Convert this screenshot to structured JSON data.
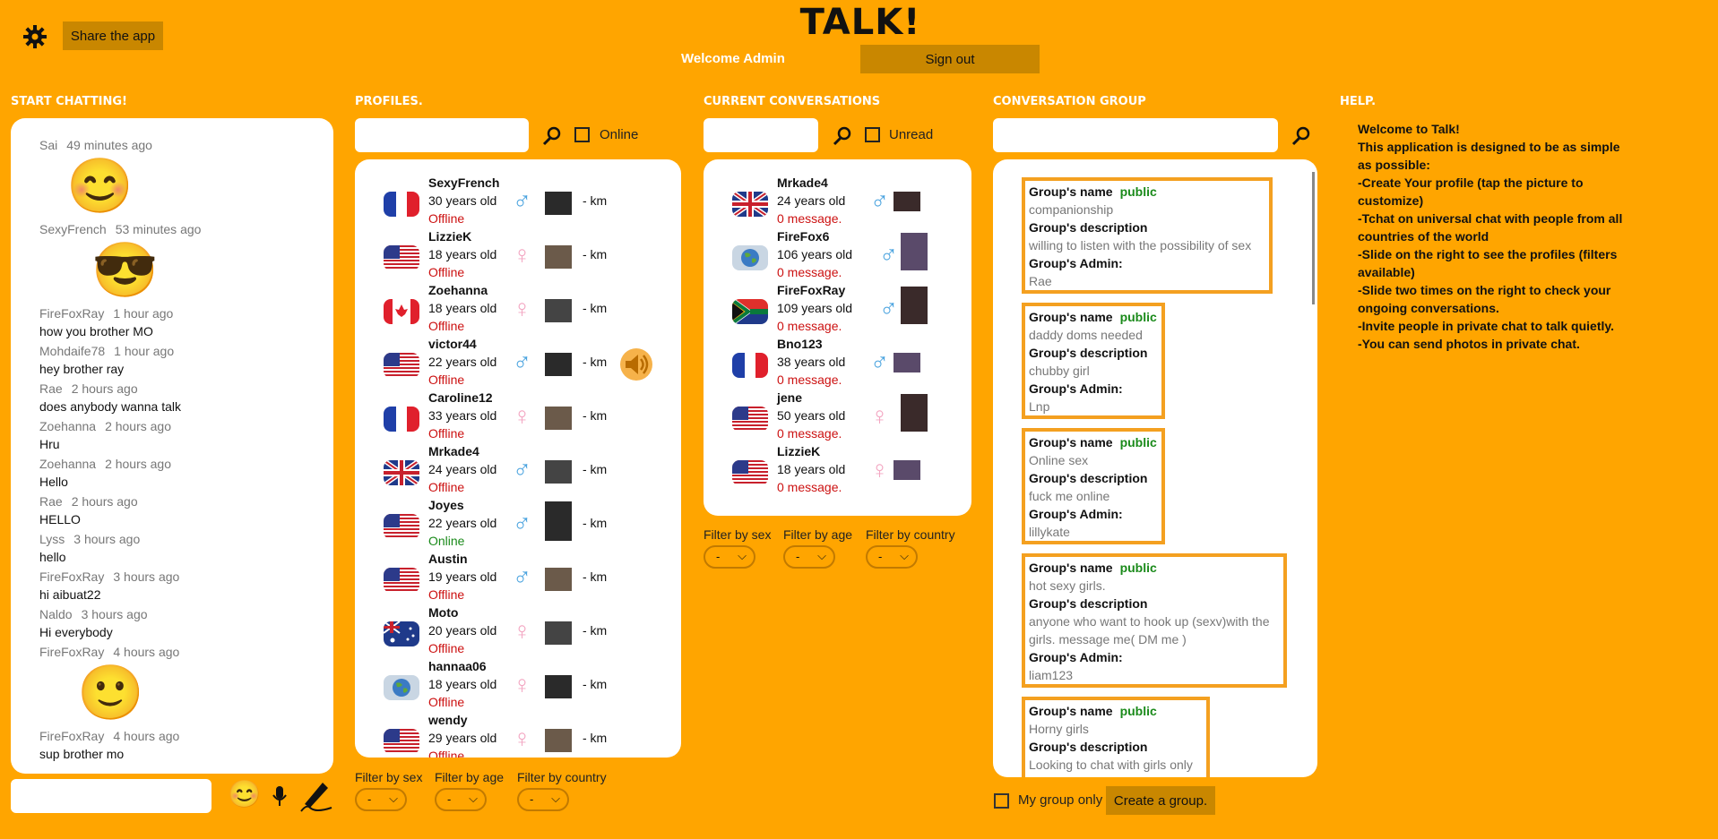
{
  "app_title": "TALK!",
  "welcome": "Welcome Admin",
  "sign_out": "Sign out",
  "share": "Share the app",
  "sections": {
    "start": "START CHATTING!",
    "profiles": "PROFILES.",
    "conversations": "CURRENT CONVERSATIONS",
    "groups": "CONVERSATION GROUP",
    "help": "HELP."
  },
  "chat": [
    {
      "user": "Sai",
      "time": "49 minutes ago",
      "text": "",
      "emoji": "😊"
    },
    {
      "user": "SexyFrench",
      "time": "53 minutes ago",
      "text": "",
      "emoji": "😎"
    },
    {
      "user": "FireFoxRay",
      "time": "1 hour ago",
      "text": "how you brother MO"
    },
    {
      "user": "Mohdaife78",
      "time": "1 hour ago",
      "text": "hey brother ray"
    },
    {
      "user": "Rae",
      "time": "2 hours ago",
      "text": "does anybody wanna talk"
    },
    {
      "user": "Zoehanna",
      "time": "2 hours ago",
      "text": "Hru"
    },
    {
      "user": "Zoehanna",
      "time": "2 hours ago",
      "text": "Hello"
    },
    {
      "user": "Rae",
      "time": "2 hours ago",
      "text": "HELLO"
    },
    {
      "user": "Lyss",
      "time": "3 hours ago",
      "text": "hello"
    },
    {
      "user": "FireFoxRay",
      "time": "3 hours ago",
      "text": "hi aibuat22"
    },
    {
      "user": "Naldo",
      "time": "3 hours ago",
      "text": "Hi everybody"
    },
    {
      "user": "FireFoxRay",
      "time": "4 hours ago",
      "text": "",
      "emoji": "🙂"
    },
    {
      "user": "FireFoxRay",
      "time": "4 hours ago",
      "text": "sup brother mo"
    }
  ],
  "profiles_online_label": "Online",
  "profiles": [
    {
      "name": "SexyFrench",
      "age": "30 years old",
      "status": "Offline",
      "sex": "male",
      "flag": "fr",
      "km": "- km"
    },
    {
      "name": "LizzieK",
      "age": "18 years old",
      "status": "Offline",
      "sex": "female",
      "flag": "us",
      "km": "- km"
    },
    {
      "name": "Zoehanna",
      "age": "18 years old",
      "status": "Offline",
      "sex": "female",
      "flag": "ca",
      "km": "- km"
    },
    {
      "name": "victor44",
      "age": "22 years old",
      "status": "Offline",
      "sex": "male",
      "flag": "us",
      "km": "- km"
    },
    {
      "name": "Caroline12",
      "age": "33 years old",
      "status": "Offline",
      "sex": "female",
      "flag": "fr",
      "km": "- km"
    },
    {
      "name": "Mrkade4",
      "age": "24 years old",
      "status": "Offline",
      "sex": "male",
      "flag": "uk",
      "km": "- km"
    },
    {
      "name": "Joyes",
      "age": "22 years old",
      "status": "Online",
      "sex": "male",
      "flag": "us",
      "km": "- km"
    },
    {
      "name": "Austin",
      "age": "19 years old",
      "status": "Offline",
      "sex": "male",
      "flag": "us",
      "km": "- km"
    },
    {
      "name": "Moto",
      "age": "20 years old",
      "status": "Offline",
      "sex": "female",
      "flag": "au",
      "km": "- km"
    },
    {
      "name": "hannaa06",
      "age": "18 years old",
      "status": "Offline",
      "sex": "female",
      "flag": "world",
      "km": "- km"
    },
    {
      "name": "wendy",
      "age": "29 years old",
      "status": "Offline",
      "sex": "female",
      "flag": "us",
      "km": "- km"
    }
  ],
  "conv_unread_label": "Unread",
  "conversations": [
    {
      "name": "Mrkade4",
      "age": "24 years old",
      "msg": "0 message.",
      "sex": "male",
      "flag": "uk"
    },
    {
      "name": "FireFox6",
      "age": "106 years old",
      "msg": "0 message.",
      "sex": "male",
      "flag": "world"
    },
    {
      "name": "FireFoxRay",
      "age": "109 years old",
      "msg": "0 message.",
      "sex": "male",
      "flag": "za"
    },
    {
      "name": "Bno123",
      "age": "38 years old",
      "msg": "0 message.",
      "sex": "male",
      "flag": "fr"
    },
    {
      "name": "jene",
      "age": "50 years old",
      "msg": "0 message.",
      "sex": "female",
      "flag": "us"
    },
    {
      "name": "LizzieK",
      "age": "18 years old",
      "msg": "0 message.",
      "sex": "female",
      "flag": "us"
    }
  ],
  "filters": {
    "sex": "Filter by sex",
    "age": "Filter by age",
    "country": "Filter by country",
    "value": "-"
  },
  "group_labels": {
    "name": "Group's name",
    "desc": "Group's description",
    "admin": "Group's Admin:",
    "public": "public"
  },
  "groups": [
    {
      "name": "companionship",
      "desc": "willing to listen with the possibility of sex",
      "admin": "Rae"
    },
    {
      "name": "daddy doms needed",
      "desc": "chubby girl",
      "admin": "Lnp"
    },
    {
      "name": "Online sex",
      "desc": "fuck  me online",
      "admin": "lillykate"
    },
    {
      "name": "hot sexy girls.",
      "desc": "anyone who want to hook up (sexv)with the girls.  message me( DM me )",
      "admin": "liam123"
    },
    {
      "name": "Horny girls",
      "desc": "Looking to chat with girls only",
      "admin": ""
    }
  ],
  "my_group_only": "My group only",
  "create_group": "Create a group.",
  "help_lines": [
    "Welcome to Talk!",
    "This application is designed to be as simple as possible:",
    "-Create Your profile (tap the picture to customize)",
    "-Tchat on universal chat with people from all countries of the world",
    "-Slide on the right to see the profiles (filters available)",
    "-Slide two times on the right to check your ongoing conversations.",
    "-Invite people in private chat to talk quietly.",
    "-You can send photos in private chat."
  ]
}
